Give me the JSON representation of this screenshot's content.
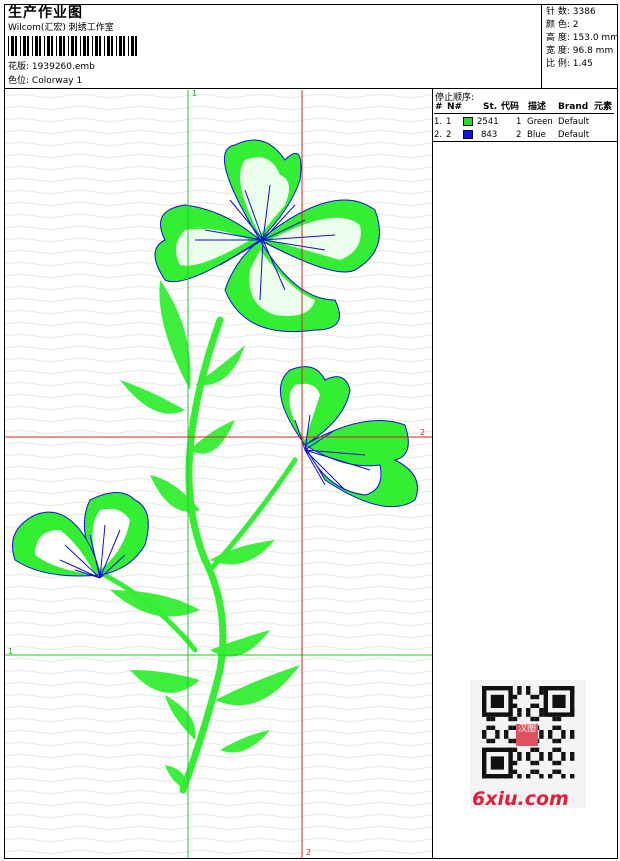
{
  "header": {
    "title": "生产作业图",
    "company": "Wilcom(汇宏) 刺绣工作室",
    "design_label": "花版:",
    "design_value": "1939260.emb",
    "colorway_label": "色位:",
    "colorway_value": "Colorway 1"
  },
  "info": [
    {
      "label": "针 数:",
      "value": "3386"
    },
    {
      "label": "颜 色:",
      "value": "2"
    },
    {
      "label": "高 度:",
      "value": "153.0 mm"
    },
    {
      "label": "宽 度:",
      "value": "96.8 mm"
    },
    {
      "label": "比 例:",
      "value": "1.45"
    }
  ],
  "stop_sequence": {
    "title": "停止顺序:",
    "columns": [
      "#",
      "N#",
      "St.",
      "代码",
      "描述",
      "Brand",
      "元素"
    ],
    "rows": [
      {
        "num": "1.",
        "needle": "1",
        "color": "#22dd22",
        "stitches": "2541",
        "code": "1",
        "desc": "Green",
        "brand": "Default"
      },
      {
        "num": "2.",
        "needle": "2",
        "color": "#1111ee",
        "stitches": "843",
        "code": "2",
        "desc": "Blue",
        "brand": "Default"
      }
    ]
  },
  "guides": {
    "top_marker": "1",
    "left_marker": "1",
    "right_marker": "2",
    "bottom_marker": "2"
  },
  "colors": {
    "guide_vertical_1": "#22cc22",
    "guide_2": "#dd2222",
    "stitch_green": "#33ee33",
    "stitch_blue": "#1010dd"
  },
  "watermark": {
    "stamp_text": "汉图",
    "site": "6xiu.com"
  }
}
